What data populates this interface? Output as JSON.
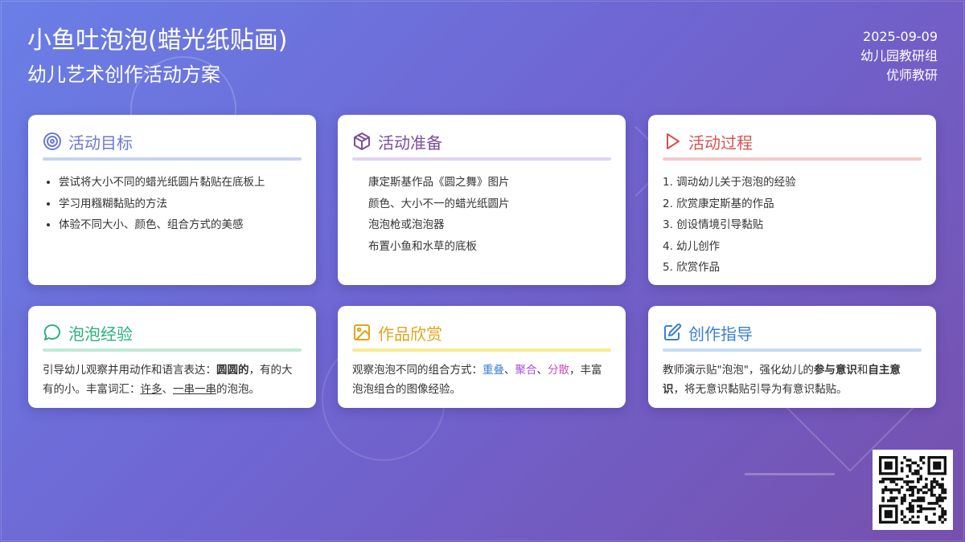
{
  "header": {
    "title": "小鱼吐泡泡(蜡光纸贴画)",
    "subtitle": "幼儿艺术创作活动方案",
    "date": "2025-09-09",
    "org": "幼儿园教研组",
    "brand": "优师教研"
  },
  "colors": {
    "goal": "#6b78d6",
    "prep": "#7a4f9c",
    "process": "#d9504f",
    "exp": "#2ab07d",
    "appre": "#e0a419",
    "guide": "#3a7fd1"
  },
  "cards": {
    "goal": {
      "icon": "target-icon",
      "title": "活动目标",
      "items": [
        "尝试将大小不同的蜡光纸圆片黏贴在底板上",
        "学习用糨糊黏贴的方法",
        "体验不同大小、颜色、组合方式的美感"
      ]
    },
    "prep": {
      "icon": "box-icon",
      "title": "活动准备",
      "items": [
        "康定斯基作品《圆之舞》图片",
        "颜色、大小不一的蜡光纸圆片",
        "泡泡枪或泡泡器",
        "布置小鱼和水草的底板"
      ]
    },
    "process": {
      "icon": "play-icon",
      "title": "活动过程",
      "items": [
        "1. 调动幼儿关于泡泡的经验",
        "2. 欣赏康定斯基的作品",
        "3. 创设情境引导黏贴",
        "4. 幼儿创作",
        "5. 欣赏作品"
      ]
    },
    "exp": {
      "icon": "chat-bubble-icon",
      "title": "泡泡经验",
      "t1": "引导幼儿观察并用动作和语言表达：",
      "b1": "圆圆的",
      "t2": "，有的大有的小。丰富词汇：",
      "u1": "许多",
      "t3": "、",
      "u2": "一串一串",
      "t4": "的泡泡。"
    },
    "appre": {
      "icon": "image-icon",
      "title": "作品欣赏",
      "t1": "观察泡泡不同的组合方式：",
      "w1": "重叠",
      "w1_color": "#3a7fd1",
      "t2": "、",
      "w2": "聚合",
      "w2_color": "#a24fc9",
      "t3": "、",
      "w3": "分散",
      "w3_color": "#c94fb8",
      "t4": "，丰富泡泡组合的图像经验。"
    },
    "guide": {
      "icon": "edit-icon",
      "title": "创作指导",
      "t1": "教师演示贴\"泡泡\"，强化幼儿的",
      "b1": "参与意识",
      "t2": "和",
      "b2": "自主意识",
      "t3": "，将无意识黏贴引导为有意识黏贴。"
    }
  },
  "qr": {
    "icon": "qr-code-icon"
  }
}
